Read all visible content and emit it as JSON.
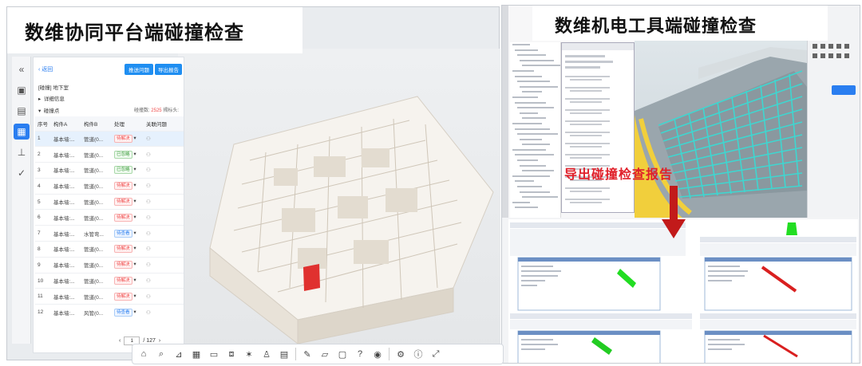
{
  "left": {
    "title": "数维协同平台端碰撞检查",
    "back_label": "返回",
    "btn_add_issue": "推送问题",
    "btn_export_report": "导出报告",
    "location_label": "[碰撞]",
    "location_value": "地下室",
    "details_label": "详细信息",
    "group_label": "碰撞点",
    "count_prefix": "碰撞数:",
    "count_value": "2525",
    "count_suffix": "揭标头:",
    "columns": [
      "序号",
      "构件A",
      "构件B",
      "处理",
      "关联问题"
    ],
    "rows": [
      {
        "no": "1",
        "a": "基本墙:...",
        "b": "管道(0...",
        "status": "待解决",
        "status_type": "red"
      },
      {
        "no": "2",
        "a": "基本墙:...",
        "b": "管道(0...",
        "status": "已忽略",
        "status_type": "green"
      },
      {
        "no": "3",
        "a": "基本墙:...",
        "b": "管道(0...",
        "status": "已忽略",
        "status_type": "green"
      },
      {
        "no": "4",
        "a": "基本墙:...",
        "b": "管道(0...",
        "status": "待解决",
        "status_type": "red"
      },
      {
        "no": "5",
        "a": "基本墙:...",
        "b": "管道(0...",
        "status": "待解决",
        "status_type": "red"
      },
      {
        "no": "6",
        "a": "基本墙:...",
        "b": "管道(0...",
        "status": "待解决",
        "status_type": "red"
      },
      {
        "no": "7",
        "a": "基本墙:...",
        "b": "水管弯...",
        "status": "待查看",
        "status_type": "blue"
      },
      {
        "no": "8",
        "a": "基本墙:...",
        "b": "管道(0...",
        "status": "待解决",
        "status_type": "red"
      },
      {
        "no": "9",
        "a": "基本墙:...",
        "b": "管道(0...",
        "status": "待解决",
        "status_type": "red"
      },
      {
        "no": "10",
        "a": "基本墙:...",
        "b": "管道(0...",
        "status": "待解决",
        "status_type": "red"
      },
      {
        "no": "11",
        "a": "基本墙:...",
        "b": "管道(0...",
        "status": "待解决",
        "status_type": "red"
      },
      {
        "no": "12",
        "a": "基本墙:...",
        "b": "风管(0...",
        "status": "待查看",
        "status_type": "blue"
      }
    ],
    "pager_current": "1",
    "pager_total": "/ 127"
  },
  "right": {
    "title": "数维机电工具端碰撞检查",
    "export_label": "导出碰撞检查报告",
    "accent_red": "#e0202a"
  },
  "colors": {
    "accent_blue": "#1f8ef1",
    "status_red": "#f04b4b",
    "status_green": "#3a9b3a",
    "model_cyan": "#3fd6d0",
    "model_yellow": "#f1cf3c"
  }
}
